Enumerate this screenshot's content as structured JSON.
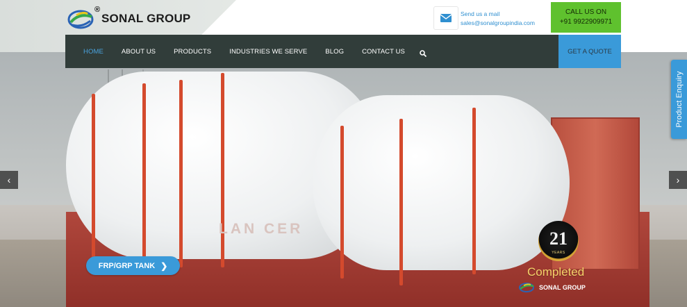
{
  "header": {
    "logo_text": "SONAL GROUP",
    "logo_reg": "®",
    "mail_label": "Send us a mail",
    "mail_address": "sales@sonalgroupindia.com",
    "call_label": "CALL US ON",
    "call_number": "+91 9922909971"
  },
  "nav": {
    "items": [
      "HOME",
      "ABOUT US",
      "PRODUCTS",
      "INDUSTRIES WE SERVE",
      "BLOG",
      "CONTACT US"
    ],
    "quote_label": "GET A QUOTE"
  },
  "hero": {
    "cta_label": "FRP/GRP TANK",
    "trailer_text": "LAN CER",
    "prev_icon": "chevron-left-icon",
    "next_icon": "chevron-right-icon"
  },
  "badge": {
    "number": "21",
    "years": "YEARS",
    "completed": "Completed",
    "logo_text": "SONAL GROUP"
  },
  "side_tab": {
    "label": "Product Enquiry"
  },
  "colors": {
    "nav_bg": "#313d3a",
    "accent_blue": "#3a9ad9",
    "call_green": "#5fc12e",
    "active_nav": "#4aa3df"
  }
}
